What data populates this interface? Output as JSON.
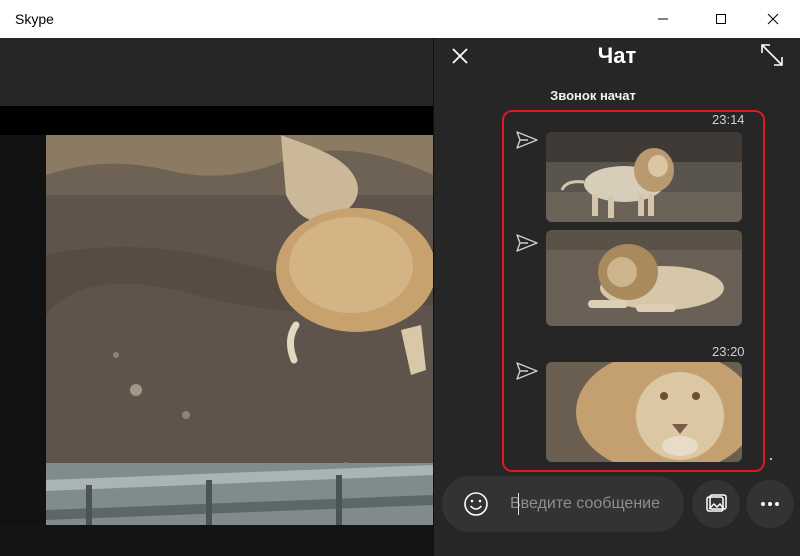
{
  "window": {
    "title": "Skype"
  },
  "chat": {
    "title": "Чат",
    "call_started": "Звонок начат",
    "messages": [
      {
        "timestamp": "23:14",
        "images": [
          "lion-standing",
          "lion-lying"
        ]
      },
      {
        "timestamp": "23:20",
        "images": [
          "lion-closeup"
        ]
      }
    ],
    "highlight_color": "#e0181f"
  },
  "composer": {
    "placeholder": "Введите сообщение"
  },
  "icons": {
    "close": "close-icon",
    "expand": "expand-icon",
    "send": "send-icon",
    "emoji": "emoji-icon",
    "media": "image-icon",
    "more": "more-icon"
  }
}
